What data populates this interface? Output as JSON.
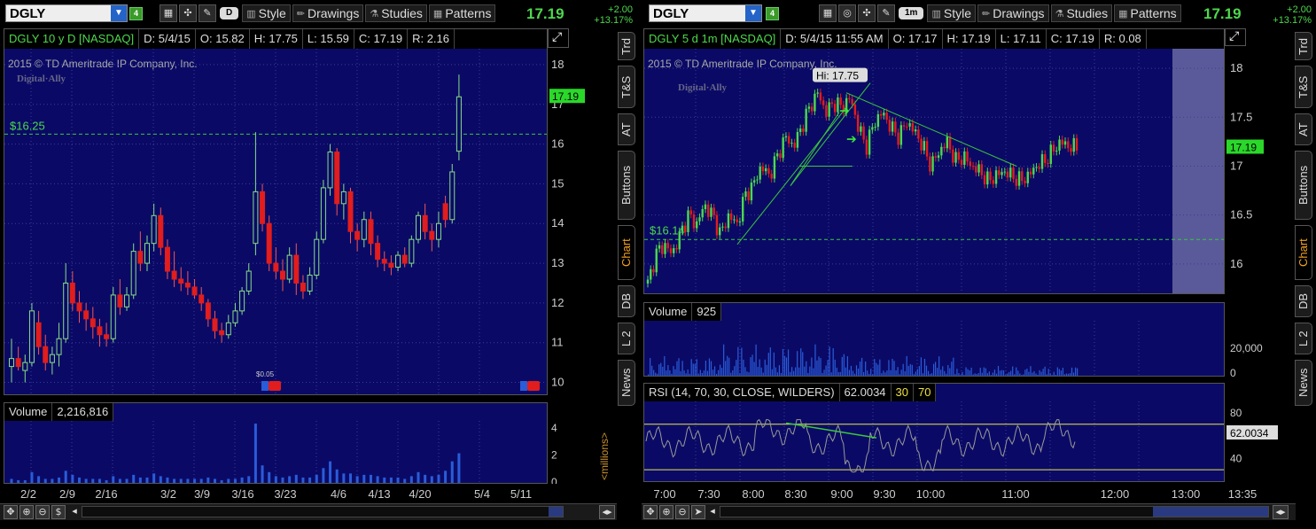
{
  "left": {
    "symbol": "DGLY",
    "link_group": "4",
    "aggregation": "D",
    "style_label": "Style",
    "drawings_label": "Drawings",
    "studies_label": "Studies",
    "patterns_label": "Patterns",
    "last_price": "17.19",
    "change_abs": "+2.00",
    "change_pct": "+13.17%",
    "header": {
      "title": "DGLY 10 y D [NASDAQ]",
      "date": "D: 5/4/15",
      "open": "O: 15.82",
      "high": "H: 17.75",
      "low": "L: 15.59",
      "close": "C: 17.19",
      "range": "R: 2.16"
    },
    "copyright": "2015 © TD Ameritrade IP Company, Inc.",
    "logo_text": "Digital·Ally",
    "price_line_label": "$16.25",
    "dividend_label": "$0.05",
    "current_price_tag": "17.19",
    "y_ticks": [
      "18",
      "17",
      "16",
      "15",
      "14",
      "13",
      "12",
      "11",
      "10"
    ],
    "volume": {
      "title": "Volume",
      "value": "2,216,816",
      "y_ticks": [
        "4",
        "2",
        "0"
      ],
      "units": "<millions>"
    },
    "x_ticks": [
      "2/2",
      "2/9",
      "2/16",
      "3/2",
      "3/9",
      "3/16",
      "3/23",
      "4/6",
      "4/13",
      "4/20",
      "5/4",
      "5/11"
    ]
  },
  "right": {
    "symbol": "DGLY",
    "link_group": "4",
    "aggregation": "1m",
    "style_label": "Style",
    "drawings_label": "Drawings",
    "studies_label": "Studies",
    "patterns_label": "Patterns",
    "last_price": "17.19",
    "change_abs": "+2.00",
    "change_pct": "+13.17%",
    "header": {
      "title": "DGLY 5 d 1m [NASDAQ]",
      "date": "D: 5/4/15 11:55 AM",
      "open": "O: 17.17",
      "high": "H: 17.19",
      "low": "L: 17.11",
      "close": "C: 17.19",
      "range": "R: 0.08"
    },
    "copyright": "2015 © TD Ameritrade IP Company, Inc.",
    "logo_text": "Digital·Ally",
    "hi_bubble": "Hi: 17.75",
    "price_line_label": "$16.14",
    "current_price_tag": "17.19",
    "y_ticks": [
      "18",
      "17.5",
      "17",
      "16.5",
      "16"
    ],
    "volume": {
      "title": "Volume",
      "value": "925",
      "y_ticks": [
        "20,000",
        "0"
      ]
    },
    "rsi": {
      "title": "RSI (14, 70, 30, CLOSE, WILDERS)",
      "value": "62.0034",
      "ob": "30",
      "os": "70",
      "y_ticks": [
        "80",
        "40"
      ],
      "tag": "62.0034"
    },
    "x_ticks": [
      "7:00",
      "7:30",
      "8:00",
      "8:30",
      "9:00",
      "9:30",
      "10:00",
      "11:00",
      "12:00",
      "13:00",
      "13:35"
    ]
  },
  "side_tabs": [
    "Trd",
    "T&S",
    "AT",
    "Buttons",
    "Chart",
    "DB",
    "L 2",
    "News"
  ],
  "icons": [
    "chart-settings-icon",
    "crosshair-icon",
    "wrench-icon",
    "style-icon",
    "drawings-icon",
    "studies-icon",
    "patterns-icon",
    "zoom-in-icon",
    "zoom-out-icon",
    "pan-icon",
    "dollar-icon",
    "cursor-icon"
  ],
  "colors": {
    "background": "#0a0a66",
    "up": "#4dd84d",
    "down": "#e11d1d",
    "price_tag": "#2ad82a",
    "volume": "#2a5cd8",
    "accent": "#f0a020"
  },
  "chart_data": [
    {
      "type": "candlestick",
      "title": "DGLY 10 y D [NASDAQ]",
      "ylim": [
        9.7,
        18.4
      ],
      "x_labels": [
        "2/2",
        "2/9",
        "2/16",
        "3/2",
        "3/9",
        "3/16",
        "3/23",
        "4/6",
        "4/13",
        "4/20",
        "5/4",
        "5/11"
      ],
      "reference_line": 16.25,
      "candles": [
        {
          "o": 10.4,
          "h": 11.1,
          "l": 10.0,
          "c": 10.6
        },
        {
          "o": 10.6,
          "h": 10.9,
          "l": 10.3,
          "c": 10.4
        },
        {
          "o": 10.3,
          "h": 10.7,
          "l": 10.0,
          "c": 10.5
        },
        {
          "o": 10.5,
          "h": 12.0,
          "l": 10.4,
          "c": 11.8
        },
        {
          "o": 11.5,
          "h": 11.8,
          "l": 10.7,
          "c": 10.9
        },
        {
          "o": 10.9,
          "h": 11.2,
          "l": 10.3,
          "c": 10.5
        },
        {
          "o": 10.5,
          "h": 10.9,
          "l": 10.2,
          "c": 10.7
        },
        {
          "o": 10.7,
          "h": 11.5,
          "l": 10.4,
          "c": 11.1
        },
        {
          "o": 11.1,
          "h": 13.0,
          "l": 11.0,
          "c": 12.5
        },
        {
          "o": 12.5,
          "h": 12.8,
          "l": 11.8,
          "c": 12.0
        },
        {
          "o": 12.0,
          "h": 12.3,
          "l": 11.5,
          "c": 11.8
        },
        {
          "o": 11.8,
          "h": 12.0,
          "l": 11.3,
          "c": 11.6
        },
        {
          "o": 11.6,
          "h": 11.9,
          "l": 11.1,
          "c": 11.4
        },
        {
          "o": 11.4,
          "h": 11.6,
          "l": 10.9,
          "c": 11.2
        },
        {
          "o": 11.2,
          "h": 11.5,
          "l": 10.9,
          "c": 11.1
        },
        {
          "o": 11.1,
          "h": 12.4,
          "l": 11.0,
          "c": 12.2
        },
        {
          "o": 12.2,
          "h": 12.6,
          "l": 11.7,
          "c": 11.9
        },
        {
          "o": 11.9,
          "h": 12.4,
          "l": 11.8,
          "c": 12.2
        },
        {
          "o": 12.2,
          "h": 13.5,
          "l": 12.1,
          "c": 13.3
        },
        {
          "o": 13.3,
          "h": 13.8,
          "l": 12.8,
          "c": 13.0
        },
        {
          "o": 13.0,
          "h": 13.7,
          "l": 12.8,
          "c": 13.5
        },
        {
          "o": 13.5,
          "h": 14.5,
          "l": 13.3,
          "c": 14.2
        },
        {
          "o": 14.2,
          "h": 14.4,
          "l": 13.2,
          "c": 13.4
        },
        {
          "o": 13.4,
          "h": 13.6,
          "l": 12.6,
          "c": 12.8
        },
        {
          "o": 12.8,
          "h": 13.3,
          "l": 12.4,
          "c": 12.6
        },
        {
          "o": 12.6,
          "h": 12.9,
          "l": 12.3,
          "c": 12.5
        },
        {
          "o": 12.5,
          "h": 12.8,
          "l": 12.2,
          "c": 12.4
        },
        {
          "o": 12.4,
          "h": 12.6,
          "l": 12.1,
          "c": 12.2
        },
        {
          "o": 12.2,
          "h": 12.4,
          "l": 11.8,
          "c": 12.0
        },
        {
          "o": 12.0,
          "h": 12.1,
          "l": 11.4,
          "c": 11.6
        },
        {
          "o": 11.6,
          "h": 11.8,
          "l": 11.1,
          "c": 11.3
        },
        {
          "o": 11.3,
          "h": 11.5,
          "l": 11.0,
          "c": 11.2
        },
        {
          "o": 11.2,
          "h": 11.7,
          "l": 11.1,
          "c": 11.5
        },
        {
          "o": 11.5,
          "h": 12.0,
          "l": 11.4,
          "c": 11.8
        },
        {
          "o": 11.8,
          "h": 12.4,
          "l": 11.7,
          "c": 12.3
        },
        {
          "o": 12.3,
          "h": 13.0,
          "l": 12.2,
          "c": 12.8
        },
        {
          "o": 13.5,
          "h": 16.3,
          "l": 13.2,
          "c": 14.8
        },
        {
          "o": 14.8,
          "h": 15.0,
          "l": 13.8,
          "c": 14.0
        },
        {
          "o": 14.0,
          "h": 14.2,
          "l": 12.8,
          "c": 13.0
        },
        {
          "o": 13.0,
          "h": 13.4,
          "l": 12.6,
          "c": 12.8
        },
        {
          "o": 12.8,
          "h": 13.1,
          "l": 12.3,
          "c": 12.6
        },
        {
          "o": 12.6,
          "h": 13.4,
          "l": 12.5,
          "c": 13.2
        },
        {
          "o": 13.2,
          "h": 13.5,
          "l": 12.2,
          "c": 12.5
        },
        {
          "o": 12.5,
          "h": 12.7,
          "l": 12.1,
          "c": 12.3
        },
        {
          "o": 12.3,
          "h": 12.9,
          "l": 12.2,
          "c": 12.7
        },
        {
          "o": 12.7,
          "h": 13.8,
          "l": 12.6,
          "c": 13.6
        },
        {
          "o": 13.6,
          "h": 15.1,
          "l": 13.5,
          "c": 14.9
        },
        {
          "o": 14.9,
          "h": 16.0,
          "l": 14.7,
          "c": 15.8
        },
        {
          "o": 15.8,
          "h": 15.9,
          "l": 14.2,
          "c": 14.5
        },
        {
          "o": 14.5,
          "h": 15.0,
          "l": 14.1,
          "c": 14.8
        },
        {
          "o": 14.8,
          "h": 14.9,
          "l": 13.5,
          "c": 13.8
        },
        {
          "o": 13.8,
          "h": 14.0,
          "l": 13.3,
          "c": 13.6
        },
        {
          "o": 13.6,
          "h": 14.3,
          "l": 13.4,
          "c": 14.1
        },
        {
          "o": 14.1,
          "h": 14.3,
          "l": 13.2,
          "c": 13.5
        },
        {
          "o": 13.5,
          "h": 13.7,
          "l": 12.9,
          "c": 13.1
        },
        {
          "o": 13.1,
          "h": 13.3,
          "l": 12.8,
          "c": 13.0
        },
        {
          "o": 13.0,
          "h": 13.2,
          "l": 12.7,
          "c": 12.9
        },
        {
          "o": 12.9,
          "h": 13.3,
          "l": 12.8,
          "c": 13.2
        },
        {
          "o": 13.2,
          "h": 13.4,
          "l": 12.9,
          "c": 13.0
        },
        {
          "o": 13.0,
          "h": 13.7,
          "l": 12.9,
          "c": 13.6
        },
        {
          "o": 13.6,
          "h": 14.3,
          "l": 13.5,
          "c": 14.2
        },
        {
          "o": 14.2,
          "h": 14.5,
          "l": 13.6,
          "c": 13.8
        },
        {
          "o": 13.8,
          "h": 14.0,
          "l": 13.3,
          "c": 13.6
        },
        {
          "o": 13.6,
          "h": 14.3,
          "l": 13.4,
          "c": 14.0
        },
        {
          "o": 14.5,
          "h": 14.7,
          "l": 13.9,
          "c": 14.1
        },
        {
          "o": 14.1,
          "h": 15.5,
          "l": 14.0,
          "c": 15.3
        },
        {
          "o": 15.82,
          "h": 17.75,
          "l": 15.59,
          "c": 17.19
        }
      ],
      "volume_millions": [
        0.3,
        0.2,
        0.2,
        0.8,
        0.5,
        0.3,
        0.3,
        0.4,
        0.9,
        0.6,
        0.4,
        0.3,
        0.3,
        0.3,
        0.2,
        0.5,
        0.3,
        0.3,
        0.6,
        0.4,
        0.4,
        0.7,
        0.5,
        0.4,
        0.3,
        0.3,
        0.3,
        0.3,
        0.3,
        0.4,
        0.3,
        0.2,
        0.3,
        0.3,
        0.4,
        0.5,
        4.4,
        1.3,
        0.8,
        0.5,
        0.4,
        0.5,
        0.6,
        0.4,
        0.4,
        0.6,
        1.1,
        1.6,
        1.0,
        0.7,
        0.7,
        0.5,
        0.6,
        0.6,
        0.5,
        0.4,
        0.4,
        0.4,
        0.3,
        0.5,
        0.8,
        0.6,
        0.5,
        0.6,
        0.9,
        1.6,
        2.2
      ]
    },
    {
      "type": "candlestick",
      "title": "DGLY 5 d 1m [NASDAQ]",
      "ylim": [
        15.7,
        18.2
      ],
      "x_labels": [
        "7:00",
        "7:30",
        "8:00",
        "8:30",
        "9:00",
        "9:30",
        "10:00",
        "11:00",
        "12:00",
        "13:00",
        "13:35"
      ],
      "reference_line": 16.25,
      "hi_marker": 17.75,
      "close_path": [
        15.8,
        16.1,
        16.2,
        16.1,
        16.3,
        16.5,
        16.4,
        16.6,
        16.5,
        16.3,
        16.5,
        16.4,
        16.7,
        16.8,
        17.0,
        16.9,
        17.1,
        17.3,
        17.2,
        17.4,
        17.6,
        17.75,
        17.55,
        17.65,
        17.6,
        17.7,
        17.4,
        17.2,
        17.45,
        17.55,
        17.4,
        17.3,
        17.45,
        17.35,
        17.2,
        17.0,
        17.15,
        17.25,
        17.05,
        17.1,
        17.0,
        16.95,
        16.85,
        16.9,
        16.95,
        16.9,
        16.85,
        16.9,
        17.0,
        17.05,
        17.15,
        17.25,
        17.2,
        17.19
      ],
      "rsi": {
        "value": 62.0034,
        "overbought": 70,
        "oversold": 30,
        "ylim": [
          20,
          90
        ]
      },
      "volume_max": 20000
    }
  ]
}
